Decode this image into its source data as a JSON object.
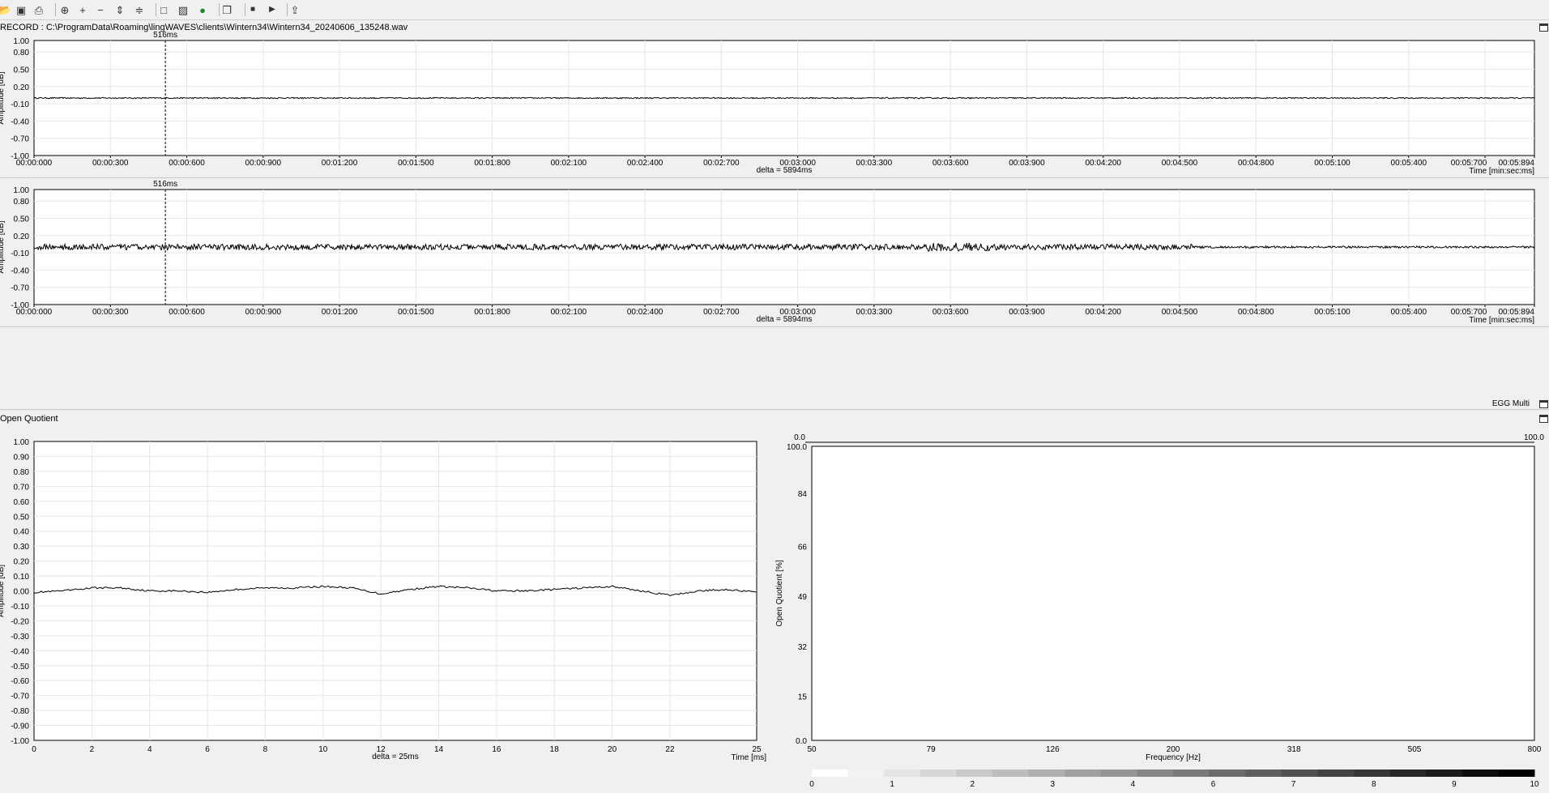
{
  "toolbar": {
    "items": [
      {
        "name": "open-icon",
        "glyph": "📂"
      },
      {
        "name": "save-icon",
        "glyph": "▣"
      },
      {
        "name": "print-icon",
        "glyph": "⎙"
      },
      {
        "name": "zoom-fit-icon",
        "glyph": "⊕"
      },
      {
        "name": "zoom-in-icon",
        "glyph": "+"
      },
      {
        "name": "zoom-out-icon",
        "glyph": "−"
      },
      {
        "name": "expand-vertical-icon",
        "glyph": "⇕"
      },
      {
        "name": "compress-vertical-icon",
        "glyph": "≑"
      },
      {
        "name": "select-all-icon",
        "glyph": "□"
      },
      {
        "name": "selection-icon",
        "glyph": "▨"
      },
      {
        "name": "record-icon",
        "glyph": "●"
      },
      {
        "name": "copy-icon",
        "glyph": "❐"
      },
      {
        "name": "stop-icon",
        "glyph": "■"
      },
      {
        "name": "play-icon",
        "glyph": "▶"
      },
      {
        "name": "export-icon",
        "glyph": "⇪"
      }
    ]
  },
  "file_path": "RECORD : C:\\ProgramData\\Roaming\\lingWAVES\\clients\\Wintern34\\Wintern34_20240606_135248.wav",
  "egg_multi_label": "EGG Multi",
  "open_quotient_panel": "Open Quotient",
  "chart_data": [
    {
      "type": "line",
      "name": "waveform-channel-1",
      "ylabel": "Amplitude [dB]",
      "xlabel": "Time [min:sec:ms]",
      "y_ticks": [
        "1.00",
        "0.80",
        "0.50",
        "0.20",
        "-0.10",
        "-0.40",
        "-0.70",
        "-1.00"
      ],
      "y_tick_values": [
        1.0,
        0.8,
        0.5,
        0.2,
        -0.1,
        -0.4,
        -0.7,
        -1.0
      ],
      "ylim": [
        -1.0,
        1.0
      ],
      "x_ticks": [
        "00:00:000",
        "00:00:300",
        "00:00:600",
        "00:00:900",
        "00:01:200",
        "00:01:500",
        "00:01:800",
        "00:02:100",
        "00:02:400",
        "00:02:700",
        "00:03:000",
        "00:03:300",
        "00:03:600",
        "00:03:900",
        "00:04:200",
        "00:04:500",
        "00:04:800",
        "00:05:100",
        "00:05:400",
        "00:05:700",
        "00:05:894"
      ],
      "x_tick_values": [
        0,
        300,
        600,
        900,
        1200,
        1500,
        1800,
        2100,
        2400,
        2700,
        3000,
        3300,
        3600,
        3900,
        4200,
        4500,
        4800,
        5100,
        5400,
        5700,
        5894
      ],
      "xlim": [
        0,
        5894
      ],
      "marker": {
        "label": "516ms",
        "x": 516
      },
      "delta": "delta = 5894ms",
      "signal": {
        "baseline": 0.0,
        "noise": 0.01
      }
    },
    {
      "type": "line",
      "name": "waveform-channel-2",
      "ylabel": "Amplitude [dB]",
      "xlabel": "Time [min:sec:ms]",
      "y_ticks": [
        "1.00",
        "0.80",
        "0.50",
        "0.20",
        "-0.10",
        "-0.40",
        "-0.70",
        "-1.00"
      ],
      "y_tick_values": [
        1.0,
        0.8,
        0.5,
        0.2,
        -0.1,
        -0.4,
        -0.7,
        -1.0
      ],
      "ylim": [
        -1.0,
        1.0
      ],
      "x_ticks": [
        "00:00:000",
        "00:00:300",
        "00:00:600",
        "00:00:900",
        "00:01:200",
        "00:01:500",
        "00:01:800",
        "00:02:100",
        "00:02:400",
        "00:02:700",
        "00:03:000",
        "00:03:300",
        "00:03:600",
        "00:03:900",
        "00:04:200",
        "00:04:500",
        "00:04:800",
        "00:05:100",
        "00:05:400",
        "00:05:700",
        "00:05:894"
      ],
      "x_tick_values": [
        0,
        300,
        600,
        900,
        1200,
        1500,
        1800,
        2100,
        2400,
        2700,
        3000,
        3300,
        3600,
        3900,
        4200,
        4500,
        4800,
        5100,
        5400,
        5700,
        5894
      ],
      "xlim": [
        0,
        5894
      ],
      "marker": {
        "label": "516ms",
        "x": 516
      },
      "delta": "delta = 5894ms",
      "signal": {
        "baseline": 0.0,
        "noise": 0.05
      }
    },
    {
      "type": "line",
      "name": "egg-cycle",
      "ylabel": "Amplitude [dB]",
      "xlabel": "Time [ms]",
      "y_ticks": [
        "1.00",
        "0.90",
        "0.80",
        "0.70",
        "0.60",
        "0.50",
        "0.40",
        "0.30",
        "0.20",
        "0.10",
        "0.00",
        "-0.10",
        "-0.20",
        "-0.30",
        "-0.40",
        "-0.50",
        "-0.60",
        "-0.70",
        "-0.80",
        "-0.90",
        "-1.00"
      ],
      "y_tick_values": [
        1.0,
        0.9,
        0.8,
        0.7,
        0.6,
        0.5,
        0.4,
        0.3,
        0.2,
        0.1,
        0.0,
        -0.1,
        -0.2,
        -0.3,
        -0.4,
        -0.5,
        -0.6,
        -0.7,
        -0.8,
        -0.9,
        -1.0
      ],
      "ylim": [
        -1.0,
        1.0
      ],
      "x_ticks": [
        "0",
        "2",
        "4",
        "6",
        "8",
        "10",
        "12",
        "14",
        "16",
        "18",
        "20",
        "22",
        "25"
      ],
      "x_tick_values": [
        0,
        2,
        4,
        6,
        8,
        10,
        12,
        14,
        16,
        18,
        20,
        22,
        25
      ],
      "xlim": [
        0,
        25
      ],
      "delta": "delta = 25ms",
      "x": [
        0,
        1,
        2,
        3,
        4,
        5,
        6,
        7,
        8,
        9,
        10,
        11,
        12,
        13,
        14,
        15,
        16,
        17,
        18,
        19,
        20,
        21,
        22,
        23,
        24,
        25
      ],
      "y": [
        -0.01,
        0.0,
        0.02,
        0.02,
        0.0,
        0.0,
        -0.01,
        0.01,
        0.02,
        0.02,
        0.03,
        0.02,
        -0.02,
        0.01,
        0.03,
        0.02,
        0.0,
        0.0,
        0.01,
        0.02,
        0.03,
        0.0,
        -0.03,
        0.0,
        0.01,
        -0.01
      ]
    },
    {
      "type": "scatter",
      "name": "open-quotient-vs-frequency",
      "ylabel": "Open Quotient [%]",
      "xlabel": "Frequency [Hz]",
      "y_ticks": [
        "100.0",
        "84",
        "66",
        "49",
        "32",
        "15",
        "0.0"
      ],
      "y_tick_values": [
        100,
        84,
        66,
        49,
        32,
        15,
        0
      ],
      "ylim": [
        0,
        100
      ],
      "x_ticks": [
        "50",
        "79",
        "126",
        "200",
        "318",
        "505",
        "800"
      ],
      "x_tick_values": [
        50,
        79,
        126,
        200,
        318,
        505,
        800
      ],
      "xscale": "log",
      "xlim": [
        50,
        800
      ],
      "corner_left": "0.0",
      "corner_right": "100.0",
      "points": [],
      "colorbar": {
        "ticks": [
          "0",
          "1",
          "2",
          "3",
          "4",
          "6",
          "7",
          "8",
          "9",
          "10"
        ],
        "tick_values": [
          0,
          1,
          2,
          3,
          4,
          6,
          7,
          8,
          9,
          10
        ]
      }
    }
  ]
}
